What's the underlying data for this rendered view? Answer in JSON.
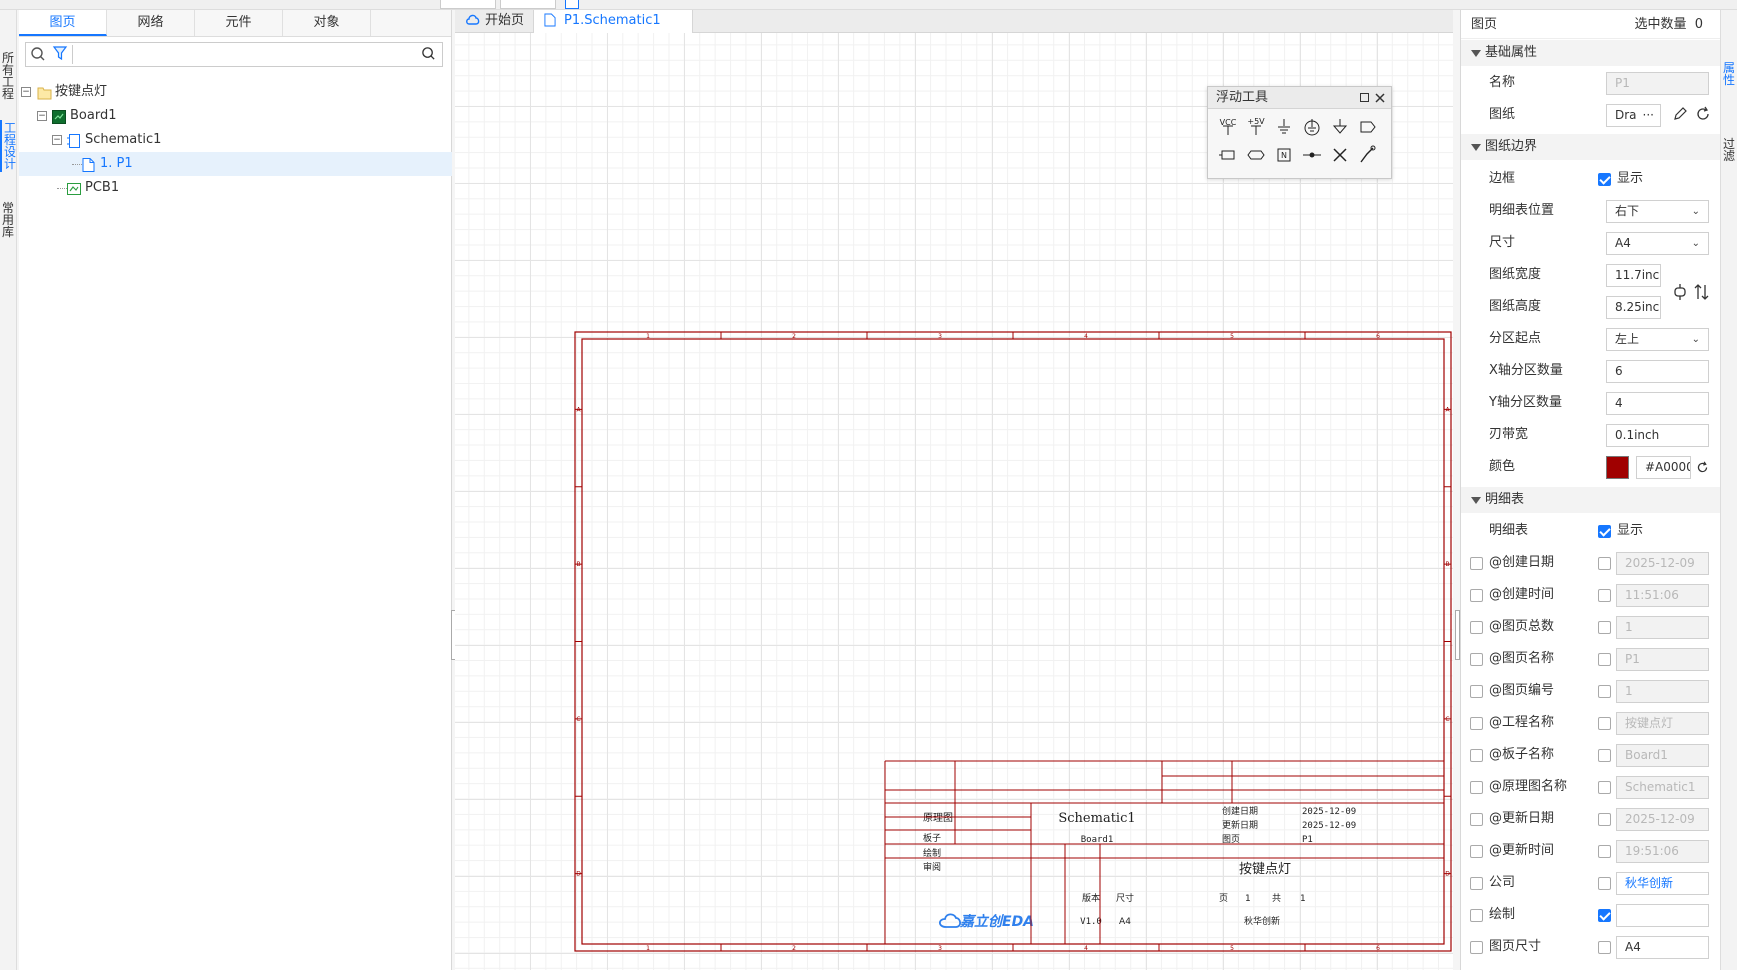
{
  "left_strip": {
    "tabs": [
      "所有工程",
      "工程设计",
      "常用库"
    ]
  },
  "left_panel": {
    "tabs": [
      "图页",
      "网络",
      "元件",
      "对象"
    ],
    "search": {
      "placeholder": ""
    },
    "tree": [
      {
        "label": "按键点灯"
      },
      {
        "label": "Board1"
      },
      {
        "label": "Schematic1"
      },
      {
        "label": "1. P1"
      },
      {
        "label": "PCB1"
      }
    ]
  },
  "doc_tabs": [
    {
      "label": "开始页"
    },
    {
      "label": "P1.Schematic1"
    }
  ],
  "float_tools": {
    "title": "浮动工具",
    "icons": [
      "vcc-icon",
      "power-port-icon",
      "ground-icon",
      "earth-ground-icon",
      "signal-ground-icon",
      "net-port-icon",
      "net-label-icon",
      "off-page-icon",
      "no-connect-flag-icon",
      "junction-icon",
      "no-connect-icon",
      "probe-icon"
    ]
  },
  "sheet": {
    "color": "#A00000",
    "x_zones": [
      "1",
      "2",
      "3",
      "4",
      "5",
      "6"
    ],
    "y_zones": [
      "A",
      "B",
      "C",
      "D"
    ],
    "title_block": {
      "type_label": "原理图",
      "schematic_name": "Schematic1",
      "created_label": "创建日期",
      "created_value": "2025-12-09",
      "updated_label": "更新日期",
      "updated_value": "2025-12-09",
      "board_label": "板子",
      "board_value": "Board1",
      "page_label": "图页",
      "page_value": "P1",
      "drawn_label": "绘制",
      "review_label": "审阅",
      "project_name": "按键点灯",
      "version_label": "版本",
      "version_value": "V1.0",
      "size_label": "尺寸",
      "size_value": "A4",
      "page_word": "页",
      "page_num": "1",
      "total_word": "共",
      "total_num": "1",
      "company": "秋华创新",
      "logo_text": "嘉立创EDA"
    }
  },
  "right_panel": {
    "header": {
      "title": "图页",
      "selected_label": "选中数量",
      "selected_count": "0"
    },
    "sections": {
      "basic": "基础属性",
      "border": "图纸边界",
      "titleblock": "明细表"
    },
    "basic": {
      "name_label": "名称",
      "name_value": "P1",
      "drawing_label": "图纸",
      "drawing_value": "Dra"
    },
    "border": {
      "frame_label": "边框",
      "frame_show": "显示",
      "tb_pos_label": "明细表位置",
      "tb_pos_value": "右下",
      "size_label": "尺寸",
      "size_value": "A4",
      "width_label": "图纸宽度",
      "width_value": "11.7inch",
      "height_label": "图纸高度",
      "height_value": "8.25inch",
      "zone_origin_label": "分区起点",
      "zone_origin_value": "左上",
      "x_zones_label": "X轴分区数量",
      "x_zones_value": "6",
      "y_zones_label": "Y轴分区数量",
      "y_zones_value": "4",
      "margin_label": "刃带宽",
      "margin_value": "0.1inch",
      "color_label": "颜色",
      "color_value": "#A00000"
    },
    "titleblock": {
      "tb_label": "明细表",
      "tb_show": "显示",
      "fields": [
        {
          "label": "@创建日期",
          "value": "2025-12-09",
          "disabled": true,
          "check2": false
        },
        {
          "label": "@创建时间",
          "value": "11:51:06",
          "disabled": true,
          "check2": false
        },
        {
          "label": "@图页总数",
          "value": "1",
          "disabled": true,
          "check2": false
        },
        {
          "label": "@图页名称",
          "value": "P1",
          "disabled": true,
          "check2": false
        },
        {
          "label": "@图页编号",
          "value": "1",
          "disabled": true,
          "check2": false
        },
        {
          "label": "@工程名称",
          "value": "按键点灯",
          "disabled": true,
          "check2": false
        },
        {
          "label": "@板子名称",
          "value": "Board1",
          "disabled": true,
          "check2": false
        },
        {
          "label": "@原理图名称",
          "value": "Schematic1",
          "disabled": true,
          "check2": false
        },
        {
          "label": "@更新日期",
          "value": "2025-12-09",
          "disabled": true,
          "check2": false
        },
        {
          "label": "@更新时间",
          "value": "19:51:06",
          "disabled": true,
          "check2": false
        },
        {
          "label": "公司",
          "value": "秋华创新",
          "disabled": false,
          "check2": false,
          "link": true
        },
        {
          "label": "绘制",
          "value": "",
          "disabled": false,
          "check2": true
        },
        {
          "label": "图页尺寸",
          "value": "A4",
          "disabled": false,
          "check2": false
        }
      ]
    }
  },
  "right_strip": {
    "tabs": [
      "属性",
      "过滤"
    ]
  }
}
